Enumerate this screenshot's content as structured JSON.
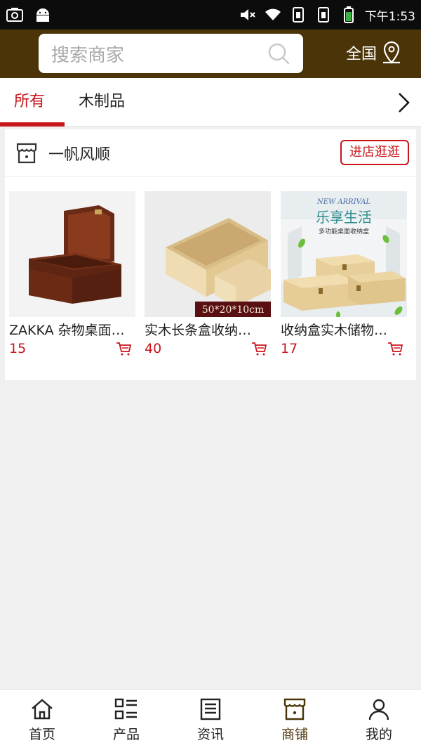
{
  "status_bar": {
    "time": "下午1:53"
  },
  "header": {
    "search_placeholder": "搜索商家",
    "region_label": "全国"
  },
  "tabs": [
    {
      "label": "所有",
      "active": true
    },
    {
      "label": "木制品",
      "active": false
    }
  ],
  "store": {
    "name": "一帆风顺",
    "visit_label": "进店逛逛",
    "products": [
      {
        "title": "ZAKKA 杂物桌面…",
        "price": "15"
      },
      {
        "title": "实木长条盒收纳…",
        "price": "40"
      },
      {
        "title": "收纳盒实木储物…",
        "price": "17"
      }
    ],
    "image_texts": {
      "size_label": "50*20*10cm",
      "new_arrival": "NEW ARRIVAL",
      "lifestyle_title": "乐享生活",
      "lifestyle_sub": "多功能桌面收纳盒"
    }
  },
  "bottom_nav": [
    {
      "label": "首页",
      "icon": "home-icon",
      "active": false
    },
    {
      "label": "产品",
      "icon": "list-icon",
      "active": false
    },
    {
      "label": "资讯",
      "icon": "news-icon",
      "active": false
    },
    {
      "label": "商铺",
      "icon": "store-icon",
      "active": true
    },
    {
      "label": "我的",
      "icon": "user-icon",
      "active": false
    }
  ],
  "colors": {
    "brand_brown": "#4b3408",
    "accent_red": "#c8161d"
  }
}
